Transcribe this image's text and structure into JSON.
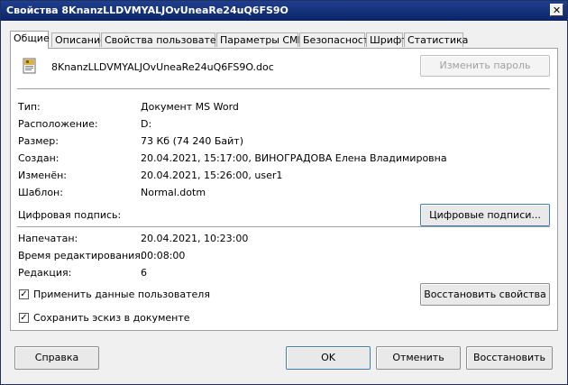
{
  "window": {
    "title": "Свойства 8KnanzLLDVMYALJOvUneaRe24uQ6FS9O",
    "close_glyph": "✕"
  },
  "tabs": [
    {
      "label": "Общие"
    },
    {
      "label": "Описание"
    },
    {
      "label": "Свойства пользователя"
    },
    {
      "label": "Параметры CMIS"
    },
    {
      "label": "Безопасность"
    },
    {
      "label": "Шрифт"
    },
    {
      "label": "Статистика"
    }
  ],
  "file": {
    "name": "8KnanzLLDVMYALJOvUneaRe24uQ6FS9O.doc",
    "icon": "word-document-icon"
  },
  "buttons": {
    "change_password": "Изменить пароль",
    "digital_signatures": "Цифровые подписи...",
    "restore_properties": "Восстановить свойства",
    "help": "Справка",
    "ok": "OK",
    "cancel": "Отменить",
    "reset": "Восстановить"
  },
  "properties": {
    "type": {
      "label": "Тип:",
      "value": "Документ MS Word"
    },
    "location": {
      "label": "Расположение:",
      "value": "D:"
    },
    "size": {
      "label": "Размер:",
      "value": "73 Кб (74 240 Байт)"
    },
    "created": {
      "label": "Создан:",
      "value": "20.04.2021, 15:17:00, ВИНОГРАДОВА Елена Владимировна"
    },
    "modified": {
      "label": "Изменён:",
      "value": "20.04.2021, 15:26:00, user1"
    },
    "template": {
      "label": "Шаблон:",
      "value": "Normal.dotm"
    },
    "digital_signature_label": "Цифровая подпись:",
    "printed": {
      "label": "Напечатан:",
      "value": "20.04.2021, 10:23:00"
    },
    "editing_time": {
      "label": "Время редактирования:",
      "value": "00:08:00"
    },
    "revision": {
      "label": "Редакция:",
      "value": "6"
    }
  },
  "checkboxes": {
    "apply_user_data": {
      "label": "Применить данные пользователя",
      "checked": true
    },
    "save_thumbnail": {
      "label": "Сохранить эскиз в документе",
      "checked": true
    }
  },
  "colors": {
    "titlebar": "#0a2468",
    "panel": "#ffffff",
    "dialog": "#f0f0f0"
  }
}
